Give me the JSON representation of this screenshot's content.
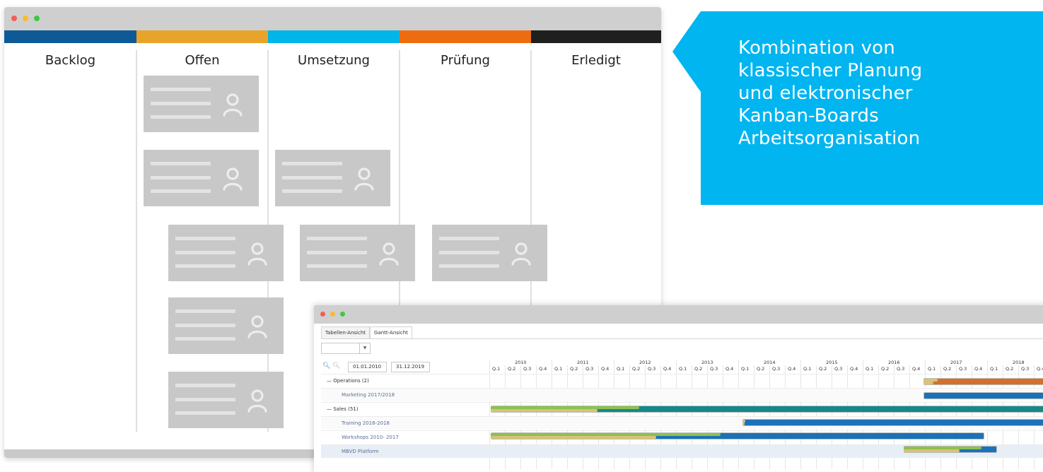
{
  "kanban": {
    "columns": [
      "Backlog",
      "Offen",
      "Umsetzung",
      "Prüfung",
      "Erledigt"
    ],
    "colors": [
      "#0e5a96",
      "#e8a42a",
      "#00b5e8",
      "#ee6c10",
      "#1f1f1f"
    ]
  },
  "callout": {
    "lines": [
      "Kombination von",
      "klassischer Planung",
      "und elektronischer",
      "Kanban-Boards",
      "Arbeitsorganisation"
    ],
    "color": "#00b5f0"
  },
  "gantt": {
    "tabs": [
      "Tabellen-Ansicht",
      "Gantt-Ansicht"
    ],
    "active_tab": 1,
    "date_from": "01.01.2010",
    "date_to": "31.12.2019",
    "zoom_in_icon": "zoom-in-icon",
    "zoom_out_icon": "zoom-out-icon",
    "years": [
      "2010",
      "2011",
      "2012",
      "2013",
      "2014",
      "2015",
      "2016",
      "2017",
      "2018"
    ],
    "quarters": [
      "Q.1",
      "Q.2",
      "Q.3",
      "Q.4"
    ],
    "rows": [
      {
        "label": "Operations (2)",
        "group": true
      },
      {
        "label": "Marketing 2017/2018",
        "group": false
      },
      {
        "label": "Sales (51)",
        "group": true
      },
      {
        "label": "Training 2016-2018",
        "group": false
      },
      {
        "label": "Workshops 2010- 2017",
        "group": false
      },
      {
        "label": "MBVD Platform",
        "group": false,
        "selected": true
      }
    ],
    "bar_colors": {
      "orange": "#d4702c",
      "blue": "#1a72b8",
      "teal": "#15898a",
      "progress": "#d9c27a",
      "progress_green": "#8cc24d"
    }
  }
}
